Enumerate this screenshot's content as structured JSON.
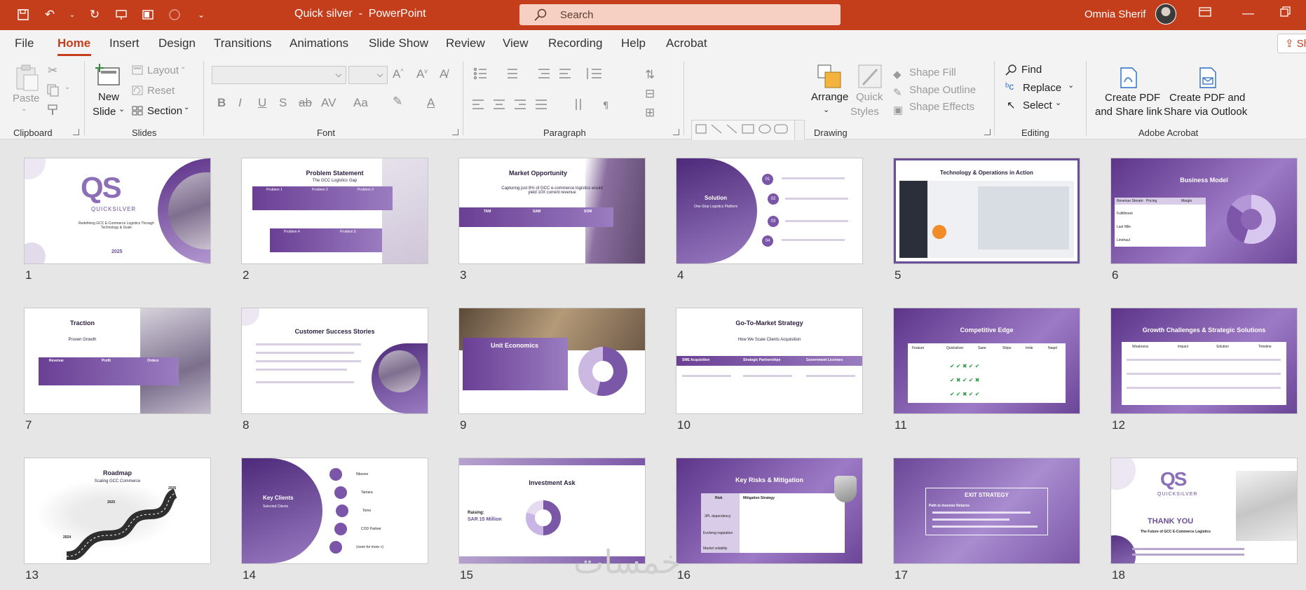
{
  "app": {
    "doc_name": "Quick silver",
    "title_sep": "  -  ",
    "app_name": "PowerPoint",
    "search_placeholder": "Search",
    "user_name": "Omnia Sherif",
    "accent": "#c43e1c"
  },
  "tabs": [
    "File",
    "Home",
    "Insert",
    "Design",
    "Transitions",
    "Animations",
    "Slide Show",
    "Review",
    "View",
    "Recording",
    "Help",
    "Acrobat"
  ],
  "active_tab": "Home",
  "share_label": "Sh",
  "ribbon": {
    "clipboard": {
      "label": "Clipboard",
      "paste": "Paste"
    },
    "slides": {
      "label": "Slides",
      "new_slide_1": "New",
      "new_slide_2": "Slide",
      "layout": "Layout",
      "reset": "Reset",
      "section": "Section"
    },
    "font": {
      "label": "Font"
    },
    "paragraph": {
      "label": "Paragraph"
    },
    "drawing": {
      "label": "Drawing",
      "arrange": "Arrange",
      "quick_styles_1": "Quick",
      "quick_styles_2": "Styles",
      "shape_fill": "Shape Fill",
      "shape_outline": "Shape Outline",
      "shape_effects": "Shape Effects"
    },
    "editing": {
      "label": "Editing",
      "find": "Find",
      "replace": "Replace",
      "select": "Select"
    },
    "acrobat": {
      "label": "Adobe Acrobat",
      "pdf_link_1": "Create PDF",
      "pdf_link_2": "and Share link",
      "pdf_outlook_1": "Create PDF and",
      "pdf_outlook_2": "Share via Outlook"
    }
  },
  "slides": [
    {
      "num": "1",
      "title": "QS",
      "subtitle": "QUICKSILVER",
      "tagline": "Redefining GCC E-Commerce Logistics Through Technology & Scale",
      "year": "2025"
    },
    {
      "num": "2",
      "title": "Problem Statement",
      "subtitle": "The GCC Logistics Gap",
      "items": [
        "Problem 1",
        "Problem 2",
        "Problem 3",
        "Problem 4",
        "Problem 5"
      ]
    },
    {
      "num": "3",
      "title": "Market Opportunity",
      "subtitle": "Capturing just 8% of GCC e-commerce logistics would yield 10X current revenue",
      "items": [
        "TAM",
        "SAM",
        "SOM"
      ]
    },
    {
      "num": "4",
      "title": "Solution",
      "subtitle": "One-Stop Logistics Platform",
      "items": [
        "01",
        "02",
        "03",
        "04"
      ]
    },
    {
      "num": "5",
      "title": "Technology & Operations in Action"
    },
    {
      "num": "6",
      "title": "Business Model",
      "items": [
        "Revenue Stream",
        "Pricing",
        "Margin",
        "Fulfillment",
        "Last Mile",
        "Linehaul"
      ]
    },
    {
      "num": "7",
      "title": "Traction",
      "subtitle": "Proven Growth",
      "items": [
        "Revenue",
        "Profit",
        "Orders"
      ]
    },
    {
      "num": "8",
      "title": "Customer Success Stories"
    },
    {
      "num": "9",
      "title": "Unit Economics"
    },
    {
      "num": "10",
      "title": "Go-To-Market Strategy",
      "subtitle": "How We Scale Clients Acquisition",
      "items": [
        "SME Acquisition",
        "Strategic Partnerships",
        "Government Licenses"
      ]
    },
    {
      "num": "11",
      "title": "Competitive Edge",
      "items": [
        "Feature",
        "Quicksilver",
        "Saee",
        "Ships",
        "Imile",
        "Naqel"
      ]
    },
    {
      "num": "12",
      "title": "Growth Challenges & Strategic Solutions",
      "items": [
        "Weakness",
        "Impact",
        "Solution",
        "Timeline"
      ]
    },
    {
      "num": "13",
      "title": "Roadmap",
      "subtitle": "Scaling GCC Commerce",
      "items": [
        "2024",
        "2025",
        "2026"
      ]
    },
    {
      "num": "14",
      "title": "Key Clients",
      "subtitle": "Selected Clients",
      "items": [
        "Nbsone",
        "Tamara",
        "Tome",
        "COD Partner",
        "(room for more +)"
      ]
    },
    {
      "num": "15",
      "title": "Investment Ask",
      "subtitle": "Raising:",
      "amount": "SAR 15 Million"
    },
    {
      "num": "16",
      "title": "Key Risks & Mitigation",
      "items": [
        "Risk",
        "Mitigation Strategy",
        "3PL dependency",
        "Evolving regulation",
        "Market volatility"
      ]
    },
    {
      "num": "17",
      "title": "EXIT STRATEGY",
      "subtitle": "Path to Investor Returns"
    },
    {
      "num": "18",
      "title": "QS",
      "subtitle": "QUICKSILVER",
      "tagline": "THANK YOU",
      "year": "The Future of GCC E-Commerce Logistics"
    }
  ],
  "watermark": "خمسات"
}
